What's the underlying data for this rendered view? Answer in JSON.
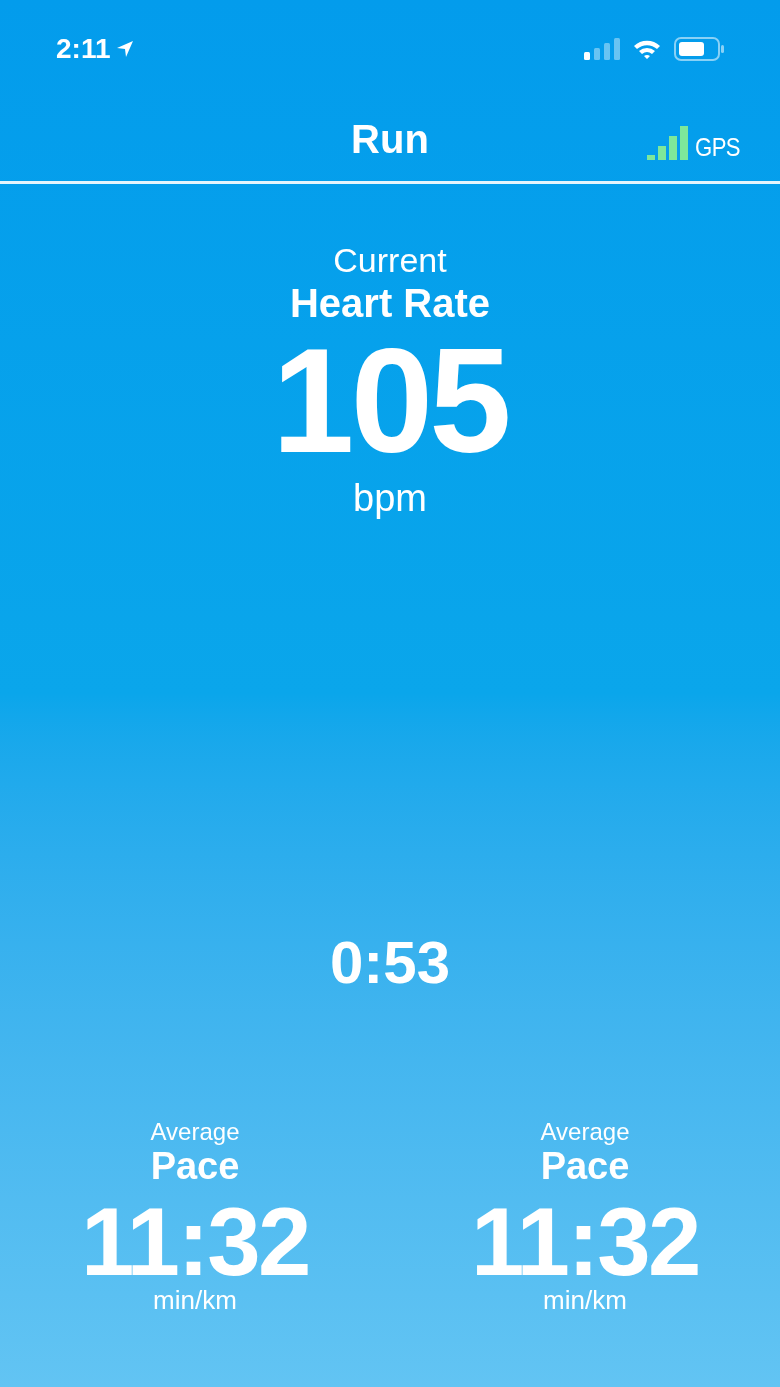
{
  "status_bar": {
    "time": "2:11"
  },
  "nav": {
    "title": "Run",
    "gps_label": "GPS"
  },
  "heart_rate": {
    "caption": "Current",
    "label": "Heart Rate",
    "value": "105",
    "unit": "bpm"
  },
  "timer": "0:53",
  "metrics": [
    {
      "caption": "Average",
      "label": "Pace",
      "value": "11:32",
      "unit": "min/km"
    },
    {
      "caption": "Average",
      "label": "Pace",
      "value": "11:32",
      "unit": "min/km"
    }
  ]
}
